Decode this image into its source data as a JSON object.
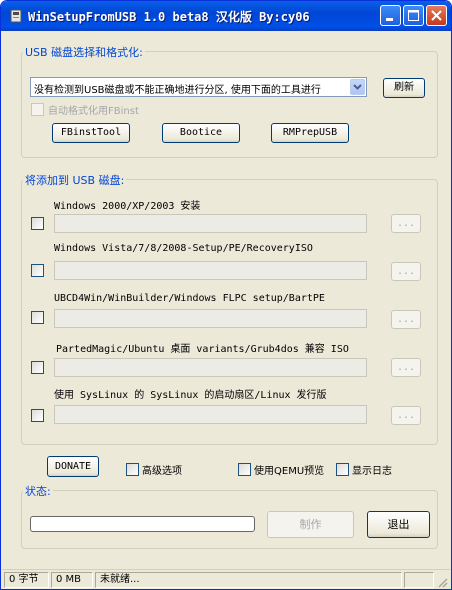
{
  "window": {
    "title": "WinSetupFromUSB 1.0 beta8 汉化版 By:cy06"
  },
  "usb_group": {
    "legend": "USB 磁盘选择和格式化:",
    "combo_value": "没有检测到USB磁盘或不能正确地进行分区, 使用下面的工具进行",
    "refresh_label": "刷新",
    "autoformat_label": "自动格式化用FBinst",
    "tools": [
      "FBinstTool",
      "Bootice",
      "RMPrepUSB"
    ]
  },
  "add_group": {
    "legend": "将添加到 USB 磁盘:",
    "items": [
      {
        "label": "Windows 2000/XP/2003 安装"
      },
      {
        "label": "Windows Vista/7/8/2008-Setup/PE/RecoveryISO"
      },
      {
        "label": "UBCD4Win/WinBuilder/Windows FLPC setup/BartPE"
      },
      {
        "label": "PartedMagic/Ubuntu 桌面 variants/Grub4dos 兼容 ISO"
      },
      {
        "label": "使用 SysLinux 的 SysLinux 的启动扇区/Linux 发行版"
      }
    ],
    "browse_label": "..."
  },
  "options": {
    "donate": "DONATE",
    "advanced": "高级选项",
    "qemu": "使用QEMU预览",
    "log": "显示日志"
  },
  "status_group": {
    "legend": "状态:",
    "progress": 0
  },
  "actions": {
    "make": "制作",
    "exit": "退出"
  },
  "statusbar": {
    "bytes": "0 字节",
    "mb": "0 MB",
    "status": "未就绪..."
  },
  "colors": {
    "title_blue": "#0046d5",
    "legend_blue": "#0046d5",
    "face": "#ece9d8",
    "close_red": "#c4391b"
  }
}
